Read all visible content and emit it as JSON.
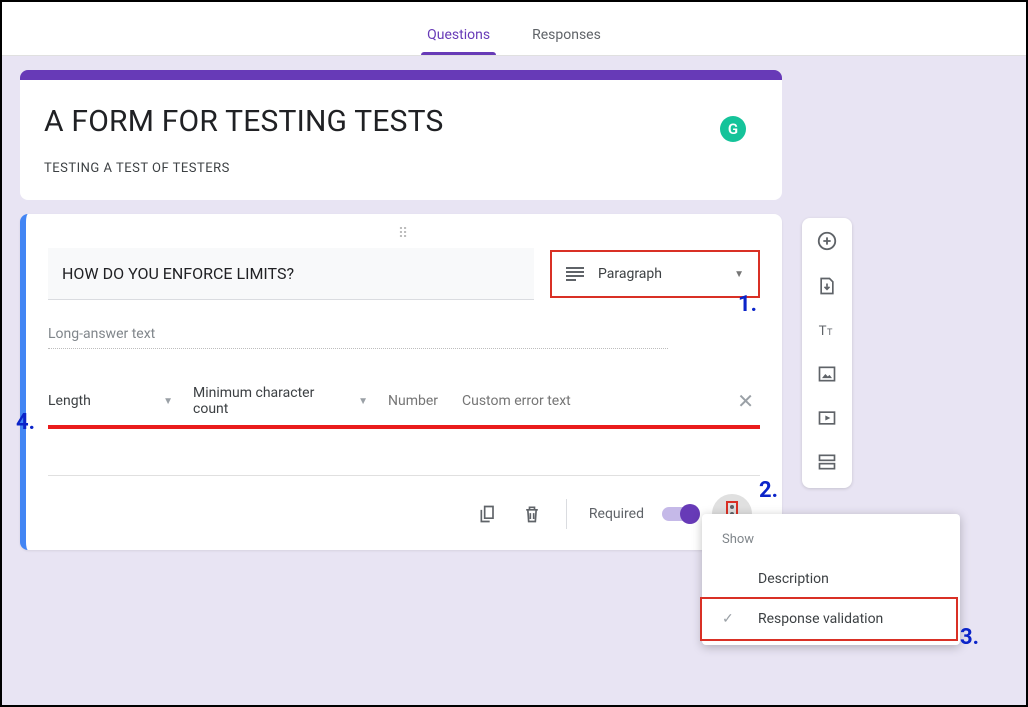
{
  "tabs": {
    "questions": "Questions",
    "responses": "Responses"
  },
  "header": {
    "title": "A FORM FOR TESTING TESTS",
    "description": "TESTING A TEST OF TESTERS",
    "grammarly_badge": "G"
  },
  "question": {
    "text": "HOW DO YOU ENFORCE LIMITS?",
    "type_label": "Paragraph",
    "long_answer_placeholder": "Long-answer text"
  },
  "validation": {
    "rule": "Length",
    "condition": "Minimum character count",
    "number_placeholder": "Number",
    "error_placeholder": "Custom error text"
  },
  "footer": {
    "required_label": "Required",
    "required_on": true
  },
  "popup": {
    "section_label": "Show",
    "items": [
      "Description",
      "Response validation"
    ],
    "selected_index": 1
  },
  "annotations": {
    "a1": "1.",
    "a2": "2.",
    "a3": "3.",
    "a4": "4."
  },
  "side_toolbar": {
    "items": [
      "add-question",
      "import-questions",
      "add-title",
      "add-image",
      "add-video",
      "add-section"
    ]
  }
}
